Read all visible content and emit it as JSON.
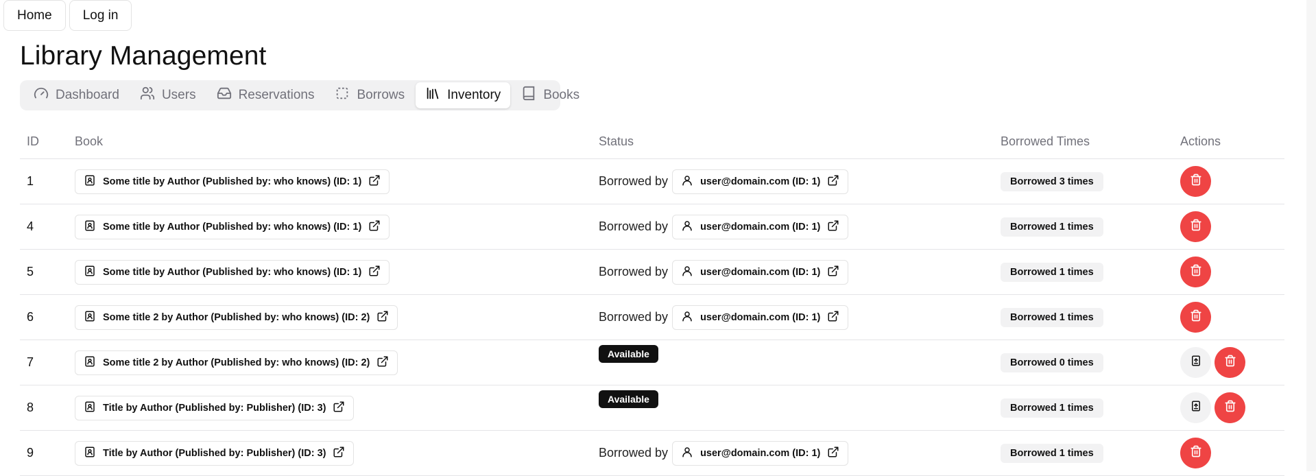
{
  "topnav": {
    "home": "Home",
    "login": "Log in"
  },
  "page_title": "Library Management",
  "tabs": [
    {
      "label": "Dashboard",
      "icon": "gauge-icon",
      "active": false
    },
    {
      "label": "Users",
      "icon": "users-icon",
      "active": false
    },
    {
      "label": "Reservations",
      "icon": "inbox-icon",
      "active": false
    },
    {
      "label": "Borrows",
      "icon": "dashed-square-icon",
      "active": false
    },
    {
      "label": "Inventory",
      "icon": "library-icon",
      "active": true
    },
    {
      "label": "Books",
      "icon": "book-icon",
      "active": false
    }
  ],
  "table": {
    "headers": [
      "ID",
      "Book",
      "Status",
      "Borrowed Times",
      "Actions"
    ],
    "borrowed_by_label": "Borrowed by",
    "rows": [
      {
        "id": "1",
        "book": "Some title by Author (Published by: who knows) (ID: 1)",
        "status": "borrowed",
        "user": "user@domain.com (ID: 1)",
        "count": "Borrowed 3 times"
      },
      {
        "id": "4",
        "book": "Some title by Author (Published by: who knows) (ID: 1)",
        "status": "borrowed",
        "user": "user@domain.com (ID: 1)",
        "count": "Borrowed 1 times"
      },
      {
        "id": "5",
        "book": "Some title by Author (Published by: who knows) (ID: 1)",
        "status": "borrowed",
        "user": "user@domain.com (ID: 1)",
        "count": "Borrowed 1 times"
      },
      {
        "id": "6",
        "book": "Some title 2 by Author (Published by: who knows) (ID: 2)",
        "status": "borrowed",
        "user": "user@domain.com (ID: 1)",
        "count": "Borrowed 1 times"
      },
      {
        "id": "7",
        "book": "Some title 2 by Author (Published by: who knows) (ID: 2)",
        "status": "available",
        "status_label": "Available",
        "count": "Borrowed 0 times"
      },
      {
        "id": "8",
        "book": "Title by Author (Published by: Publisher) (ID: 3)",
        "status": "available",
        "status_label": "Available",
        "count": "Borrowed 1 times"
      },
      {
        "id": "9",
        "book": "Title by Author (Published by: Publisher) (ID: 3)",
        "status": "borrowed",
        "user": "user@domain.com (ID: 1)",
        "count": "Borrowed 1 times"
      }
    ]
  },
  "colors": {
    "danger": "#ef4444",
    "badge_dark": "#111111",
    "muted": "#71717a"
  }
}
